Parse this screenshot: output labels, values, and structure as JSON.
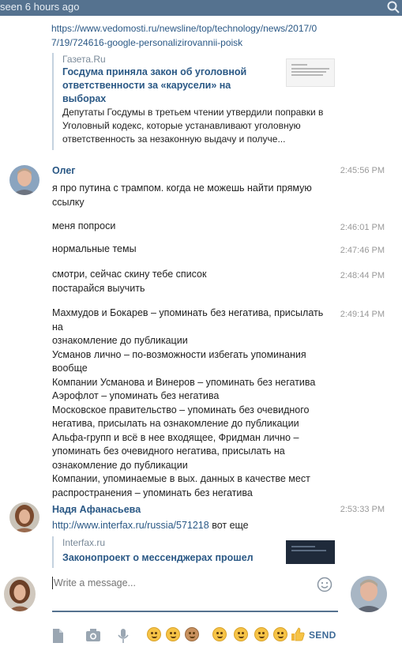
{
  "topbar": {
    "status": "seen 6 hours ago",
    "search_icon": "search-icon"
  },
  "message_block_1": {
    "url": "https://www.vedomosti.ru/newsline/top/technology/news/2017/0 7/19/724616-google-personalizirovannii-poisk",
    "url_lines": [
      "https://www.vedomosti.ru/newsline/top/technology/news/2017/0",
      "7/19/724616-google-personalizirovannii-poisk"
    ],
    "preview": {
      "site": "Газета.Ru",
      "title_lines": [
        "Госдума приняла закон об уголовной",
        "ответственности за «карусели» на",
        "выборах"
      ],
      "desc_lines": [
        "Депутаты Госдумы в третьем чтении утвердили поправки в",
        "Уголовный кодекс, которые устанавливают уголовную",
        "ответственность за незаконную выдачу и получе..."
      ]
    }
  },
  "messages": [
    {
      "author": "Олег",
      "entries": [
        {
          "time": "2:45:56 PM",
          "lines": [
            "я про путина с трампом. когда не можешь найти прямую",
            "ссылку"
          ]
        },
        {
          "time": "2:46:01 PM",
          "lines": [
            "меня попроси"
          ]
        },
        {
          "time": "2:47:46 PM",
          "lines": [
            "нормальные темы"
          ]
        },
        {
          "time": "2:48:44 PM",
          "lines": [
            "смотри, сейчас скину тебе список",
            "постарайся выучить"
          ]
        },
        {
          "time": "2:49:14 PM",
          "lines": [
            "Махмудов и Бокарев –  упоминать без негатива, присылать на",
            "ознакомление до публикации",
            "Усманов лично   –  по-возможности избегать упоминания",
            "вообще",
            "Компании Усманова и Винеров  –  упоминать без негатива",
            "Аэрофлот  –  упоминать без негатива",
            "Московское правительство  –  упоминать без очевидного",
            "негатива, присылать на ознакомление до публикации",
            "Альфа-групп и всё в нее входящее, Фридман лично –",
            "упоминать без очевидного негатива, присылать на",
            "ознакомление до публикации",
            "Компании, упоминаемые в вых. данных в качестве мест",
            "распространения – упоминать без негатива"
          ]
        }
      ]
    },
    {
      "author": "Надя Афанасьева",
      "entries": [
        {
          "time": "2:53:33 PM",
          "link": "http://www.interfax.ru/russia/571218",
          "after_link": " вот еще"
        }
      ],
      "preview": {
        "site": "Interfax.ru",
        "title": "Законопроект о мессенджерах прошел"
      }
    }
  ],
  "composer": {
    "placeholder": "Write a message...",
    "send_label": "SEND",
    "tools": [
      "file-icon",
      "camera-icon",
      "microphone-icon"
    ],
    "emojis": [
      "crying-face",
      "smirking-face",
      "monkey-face",
      "confused-face",
      "neutral-face",
      "happy-face",
      "grinning-face",
      "thumbs-up"
    ]
  },
  "colors": {
    "topbar": "#55728f",
    "link": "#2a5885",
    "accent": "#3d6a97"
  }
}
